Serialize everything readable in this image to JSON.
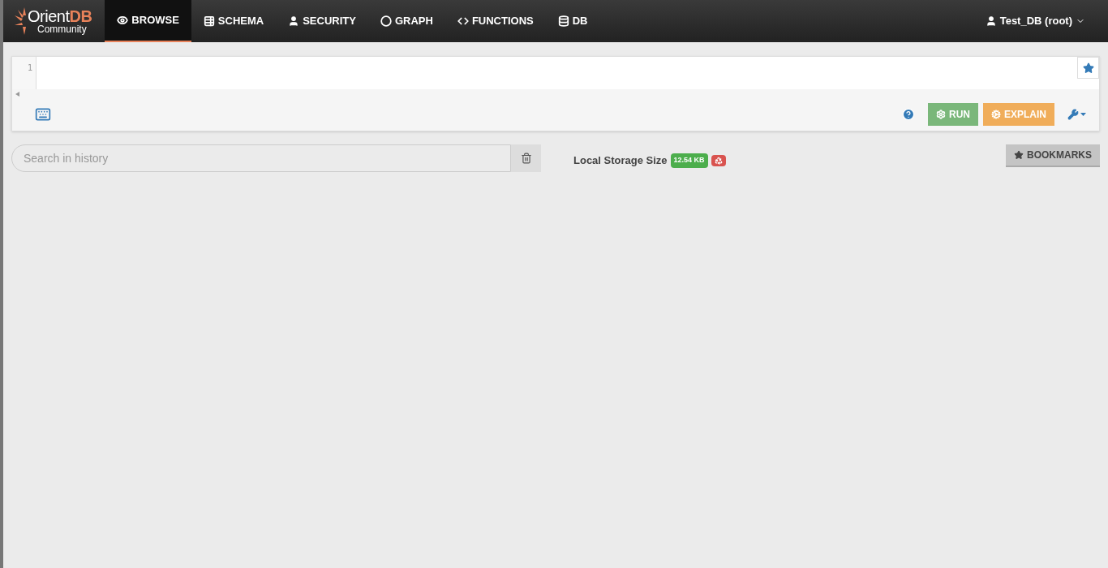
{
  "brand": {
    "name": "Orient",
    "name_bold": "DB",
    "subtitle": "Community"
  },
  "nav": [
    {
      "kind": "eye",
      "label": "BROWSE",
      "selected": true
    },
    {
      "kind": "list",
      "label": "SCHEMA",
      "selected": false
    },
    {
      "kind": "user",
      "label": "SECURITY",
      "selected": false
    },
    {
      "kind": "circle",
      "label": "GRAPH",
      "selected": false
    },
    {
      "kind": "code",
      "label": "FUNCTIONS",
      "selected": false
    },
    {
      "kind": "database",
      "label": "DB",
      "selected": false
    }
  ],
  "user_menu": {
    "label": "Test_DB (root)"
  },
  "editor": {
    "line_numbers": [
      "1"
    ]
  },
  "toolbar": {
    "run": "RUN",
    "explain": "EXPLAIN"
  },
  "history": {
    "placeholder": "Search in history"
  },
  "storage": {
    "label": "Local Storage Size",
    "size": "12.54 KB"
  },
  "bookmarks": {
    "label": "BOOKMARKS"
  }
}
